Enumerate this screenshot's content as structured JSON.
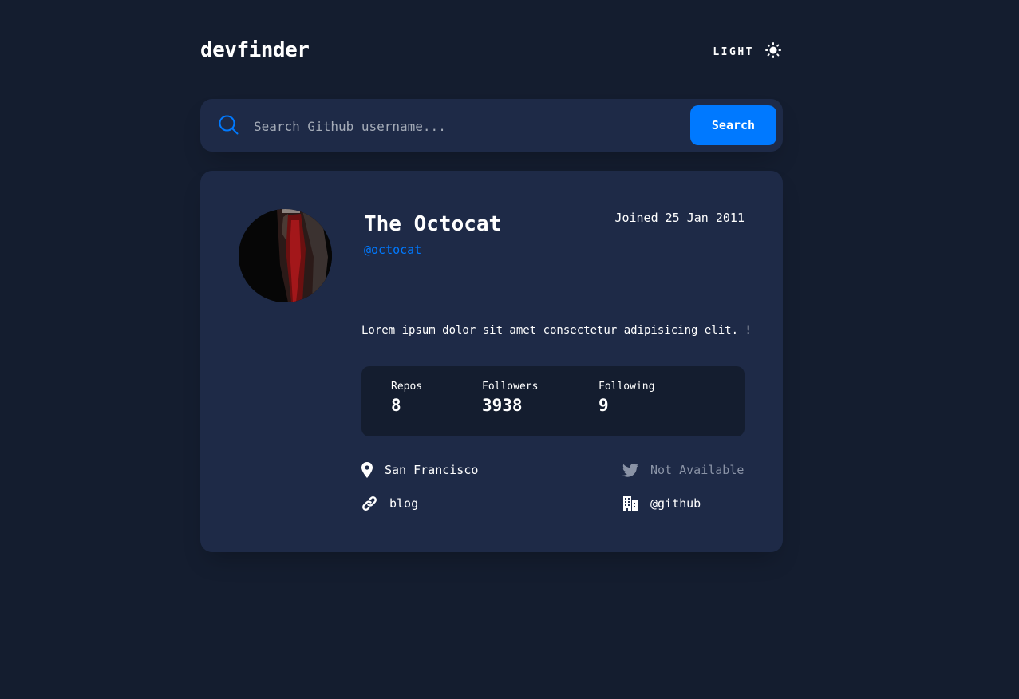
{
  "app": {
    "logo": "devfinder",
    "theme_toggle_label": "LIGHT",
    "theme_icon": "sun-icon"
  },
  "search": {
    "placeholder": "Search Github username...",
    "value": "",
    "button_label": "Search",
    "icon": "search-icon"
  },
  "profile": {
    "name": "The Octocat",
    "handle": "@octocat",
    "joined": "Joined 25 Jan 2011",
    "bio": "Lorem ipsum dolor sit amet consectetur adipisicing elit. !",
    "stats": [
      {
        "label": "Repos",
        "value": "8"
      },
      {
        "label": "Followers",
        "value": "3938"
      },
      {
        "label": "Following",
        "value": "9"
      }
    ],
    "links": {
      "location": {
        "icon": "location-pin-icon",
        "text": "San Francisco"
      },
      "twitter": {
        "icon": "twitter-icon",
        "text": "Not Available"
      },
      "blog": {
        "icon": "link-icon",
        "text": "blog"
      },
      "company": {
        "icon": "building-icon",
        "text": "@github"
      }
    }
  },
  "colors": {
    "background": "#141d2f",
    "card": "#1e2a47",
    "accent": "#0079ff",
    "muted": "#8a93a6"
  }
}
